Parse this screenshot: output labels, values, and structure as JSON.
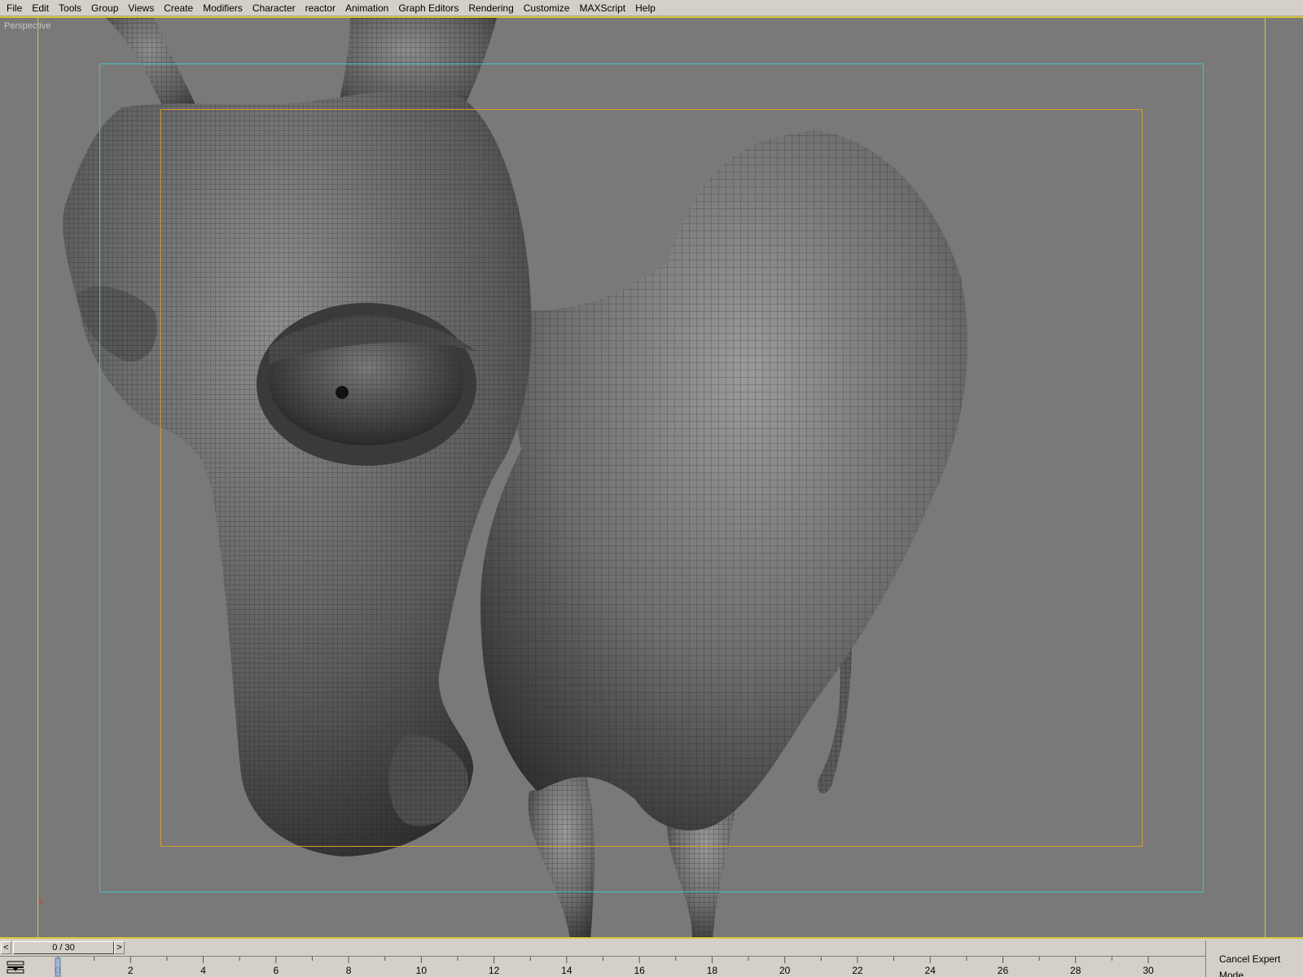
{
  "menubar": {
    "items": [
      {
        "label": "File"
      },
      {
        "label": "Edit"
      },
      {
        "label": "Tools"
      },
      {
        "label": "Group"
      },
      {
        "label": "Views"
      },
      {
        "label": "Create"
      },
      {
        "label": "Modifiers"
      },
      {
        "label": "Character"
      },
      {
        "label": "reactor"
      },
      {
        "label": "Animation"
      },
      {
        "label": "Graph Editors"
      },
      {
        "label": "Rendering"
      },
      {
        "label": "Customize"
      },
      {
        "label": "MAXScript"
      },
      {
        "label": "Help"
      }
    ]
  },
  "viewport": {
    "label": "Perspective",
    "axis_label": "x",
    "frame_colors": {
      "outer": "#d8c53a",
      "action_safe": "#3fc1c9",
      "title_safe": "#d89a2c"
    }
  },
  "time_slider": {
    "prev_label": "<",
    "next_label": ">",
    "current_label": "0 / 30",
    "current_frame": 0,
    "total_frames": 30
  },
  "trackbar": {
    "tick_labels": [
      "0",
      "2",
      "4",
      "6",
      "8",
      "10",
      "12",
      "14",
      "16",
      "18",
      "20",
      "22",
      "24",
      "26",
      "28",
      "30"
    ],
    "icon": "timeline-filter-icon"
  },
  "expert_mode": {
    "button_label": "Cancel Expert Mode"
  }
}
